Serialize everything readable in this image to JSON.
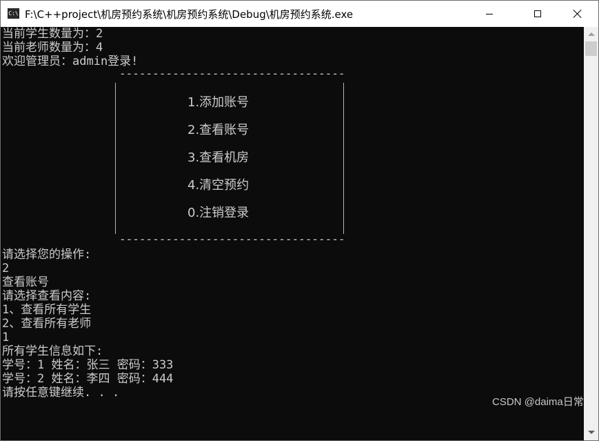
{
  "window": {
    "title": "F:\\C++project\\机房预约系统\\机房预约系统\\Debug\\机房预约系统.exe",
    "app_icon": "C:\\"
  },
  "console": {
    "lines": [
      "当前学生数量为：2",
      "当前老师数量为：4",
      "欢迎管理员：admin登录!"
    ],
    "dash": "-----------------------------------------------",
    "menu": [
      "1.添加账号",
      "2.查看账号",
      "3.查看机房",
      "4.清空预约",
      "0.注销登录"
    ],
    "after": [
      "请选择您的操作:",
      "2",
      "查看账号",
      "请选择查看内容:",
      "1、查看所有学生",
      "2、查看所有老师",
      "1",
      "所有学生信息如下:",
      "学号：1 姓名：张三 密码：333",
      "学号：2 姓名：李四 密码：444",
      "请按任意键继续. . ."
    ]
  },
  "watermark": "CSDN @daima日常",
  "colors": {
    "console_bg": "#0c0c0c",
    "console_fg": "#cccccc",
    "titlebar_bg": "#ffffff"
  },
  "icons": {
    "minimize": "minimize-icon",
    "maximize": "maximize-icon",
    "close": "close-icon"
  }
}
